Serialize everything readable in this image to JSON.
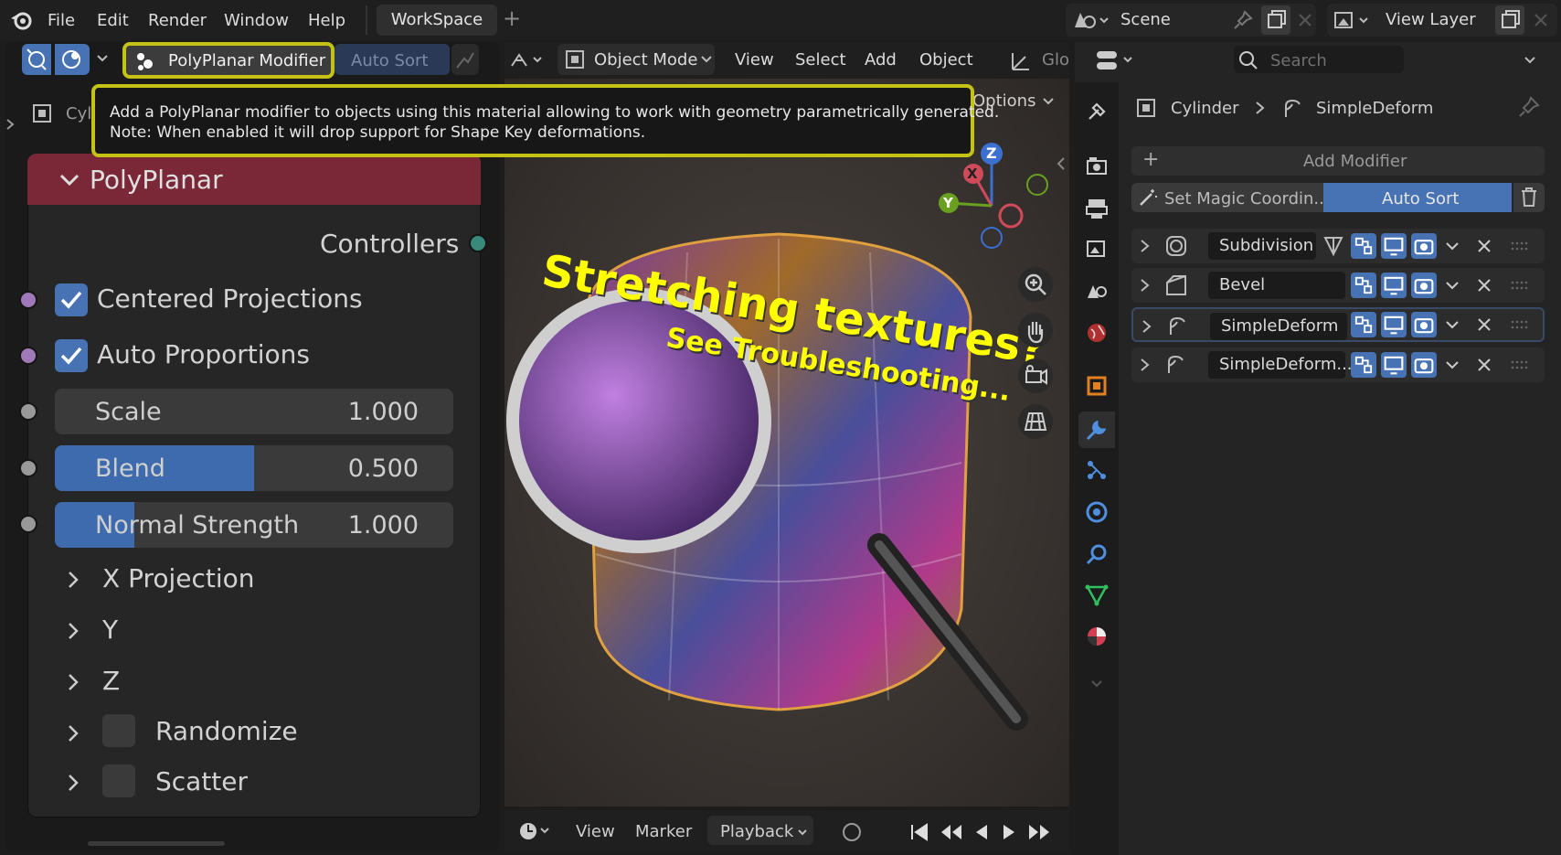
{
  "topbar": {
    "menus": [
      "File",
      "Edit",
      "Render",
      "Window",
      "Help"
    ],
    "workspace_tab": "WorkSpace",
    "add_tab": "+",
    "scene_label": "Scene",
    "view_layer_label": "View Layer"
  },
  "node_toolbar": {
    "polyplanar_button": "PolyPlanar Modifier",
    "auto_sort_button": "Auto Sort"
  },
  "tooltip": {
    "line1": "Add a PolyPlanar modifier to objects using this material allowing to work with geometry parametrically generated.",
    "line2": "Note: When enabled it will drop support for Shape Key deformations."
  },
  "node_breadcrumb": "Cyl",
  "node": {
    "title": "PolyPlanar",
    "controllers_label": "Controllers",
    "centered_projections": "Centered Projections",
    "auto_proportions": "Auto Proportions",
    "scale_label": "Scale",
    "scale_value": "1.000",
    "blend_label": "Blend",
    "blend_value": "0.500",
    "blend_fill": 0.5,
    "normal_strength_label": "Normal Strength",
    "normal_strength_value": "1.000",
    "normal_strength_fill": 0.2,
    "x_projection": "X Projection",
    "y_projection": "Y",
    "z_projection": "Z",
    "randomize": "Randomize",
    "scatter": "Scatter"
  },
  "viewport": {
    "mode": "Object Mode",
    "menus": [
      "View",
      "Select",
      "Add",
      "Object"
    ],
    "global": "Glo",
    "options": "Options",
    "overlay_title": "Stretching textures?",
    "overlay_subtitle": "See Troubleshooting...",
    "gizmo_x": "X",
    "gizmo_y": "Y",
    "gizmo_z": "Z"
  },
  "timeline": {
    "menus": [
      "View",
      "Marker",
      "Playback"
    ]
  },
  "properties": {
    "search_placeholder": "Search",
    "breadcrumb_object": "Cylinder",
    "breadcrumb_modifier": "SimpleDeform",
    "add_modifier": "Add Modifier",
    "set_magic": "Set Magic Coordin...",
    "auto_sort": "Auto Sort",
    "modifiers": [
      "Subdivision",
      "Bevel",
      "SimpleDeform",
      "SimpleDeform...."
    ]
  },
  "colors": {
    "accent": "#4772b3",
    "node_header": "#7a2837",
    "highlight": "#c5c216",
    "overlay_text": "#ffff00"
  }
}
